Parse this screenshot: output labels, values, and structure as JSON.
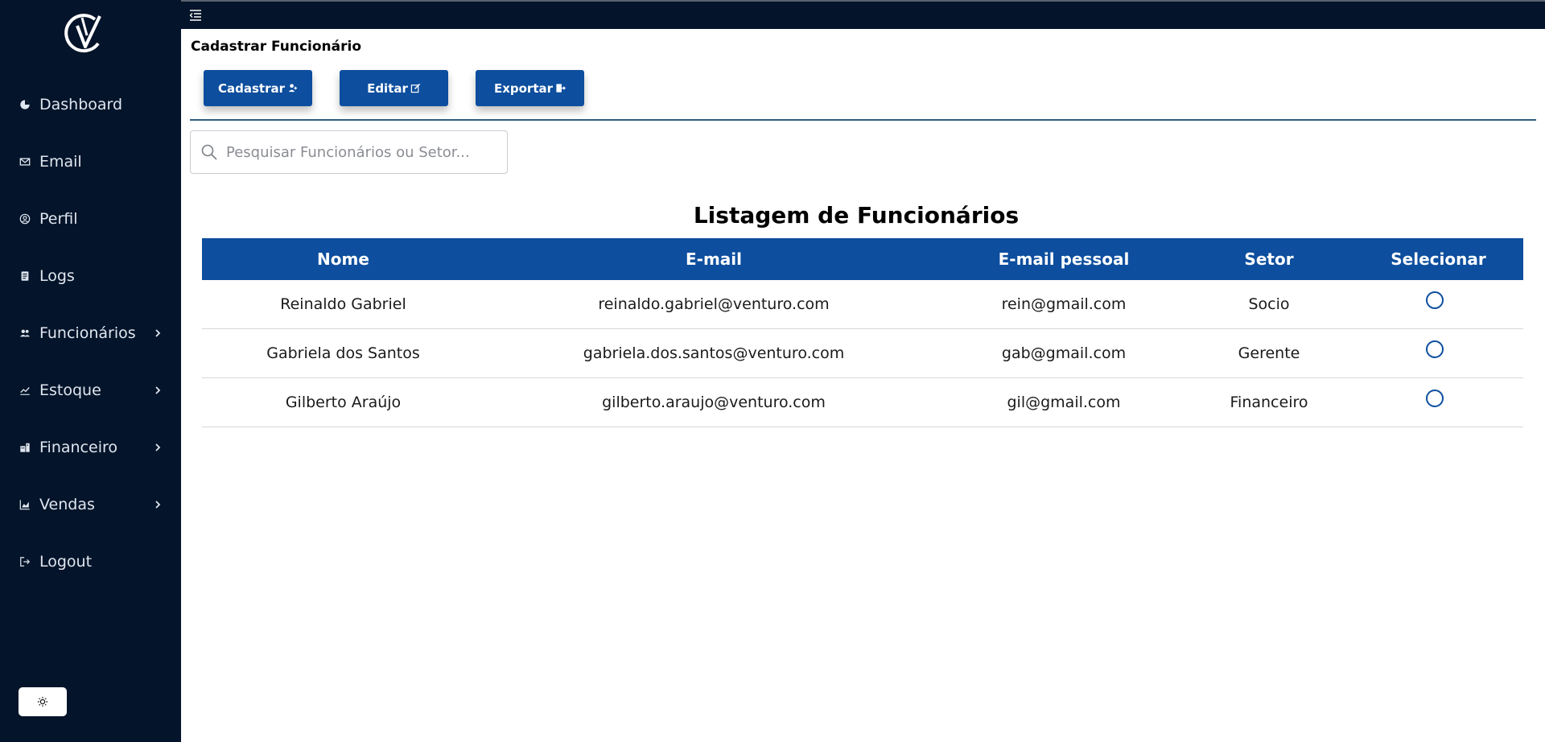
{
  "sidebar": {
    "items": [
      {
        "label": "Dashboard",
        "icon": "pie-chart-icon"
      },
      {
        "label": "Email",
        "icon": "mail-icon"
      },
      {
        "label": "Perfil",
        "icon": "user-circle-icon"
      },
      {
        "label": "Logs",
        "icon": "file-icon"
      },
      {
        "label": "Funcionários",
        "icon": "users-icon"
      },
      {
        "label": "Estoque",
        "icon": "trend-icon"
      },
      {
        "label": "Financeiro",
        "icon": "building-icon"
      },
      {
        "label": "Vendas",
        "icon": "bar-chart-icon"
      },
      {
        "label": "Logout",
        "icon": "logout-icon"
      }
    ]
  },
  "page": {
    "title": "Cadastrar Funcionário"
  },
  "toolbar": {
    "cadastrar_label": "Cadastrar",
    "editar_label": "Editar",
    "exportar_label": "Exportar"
  },
  "search": {
    "placeholder": "Pesquisar Funcionários ou Setor...",
    "value": ""
  },
  "table": {
    "title": "Listagem de Funcionários",
    "headers": [
      "Nome",
      "E-mail",
      "E-mail pessoal",
      "Setor",
      "Selecionar"
    ],
    "rows": [
      {
        "nome": "Reinaldo Gabriel",
        "email": "reinaldo.gabriel@venturo.com",
        "email_pessoal": "rein@gmail.com",
        "setor": "Socio"
      },
      {
        "nome": "Gabriela dos Santos",
        "email": "gabriela.dos.santos@venturo.com",
        "email_pessoal": "gab@gmail.com",
        "setor": "Gerente"
      },
      {
        "nome": "Gilberto Araújo",
        "email": "gilberto.araujo@venturo.com",
        "email_pessoal": "gil@gmail.com",
        "setor": "Financeiro"
      }
    ]
  },
  "colors": {
    "sidebar_bg": "#04142a",
    "primary": "#0d4e9e"
  }
}
